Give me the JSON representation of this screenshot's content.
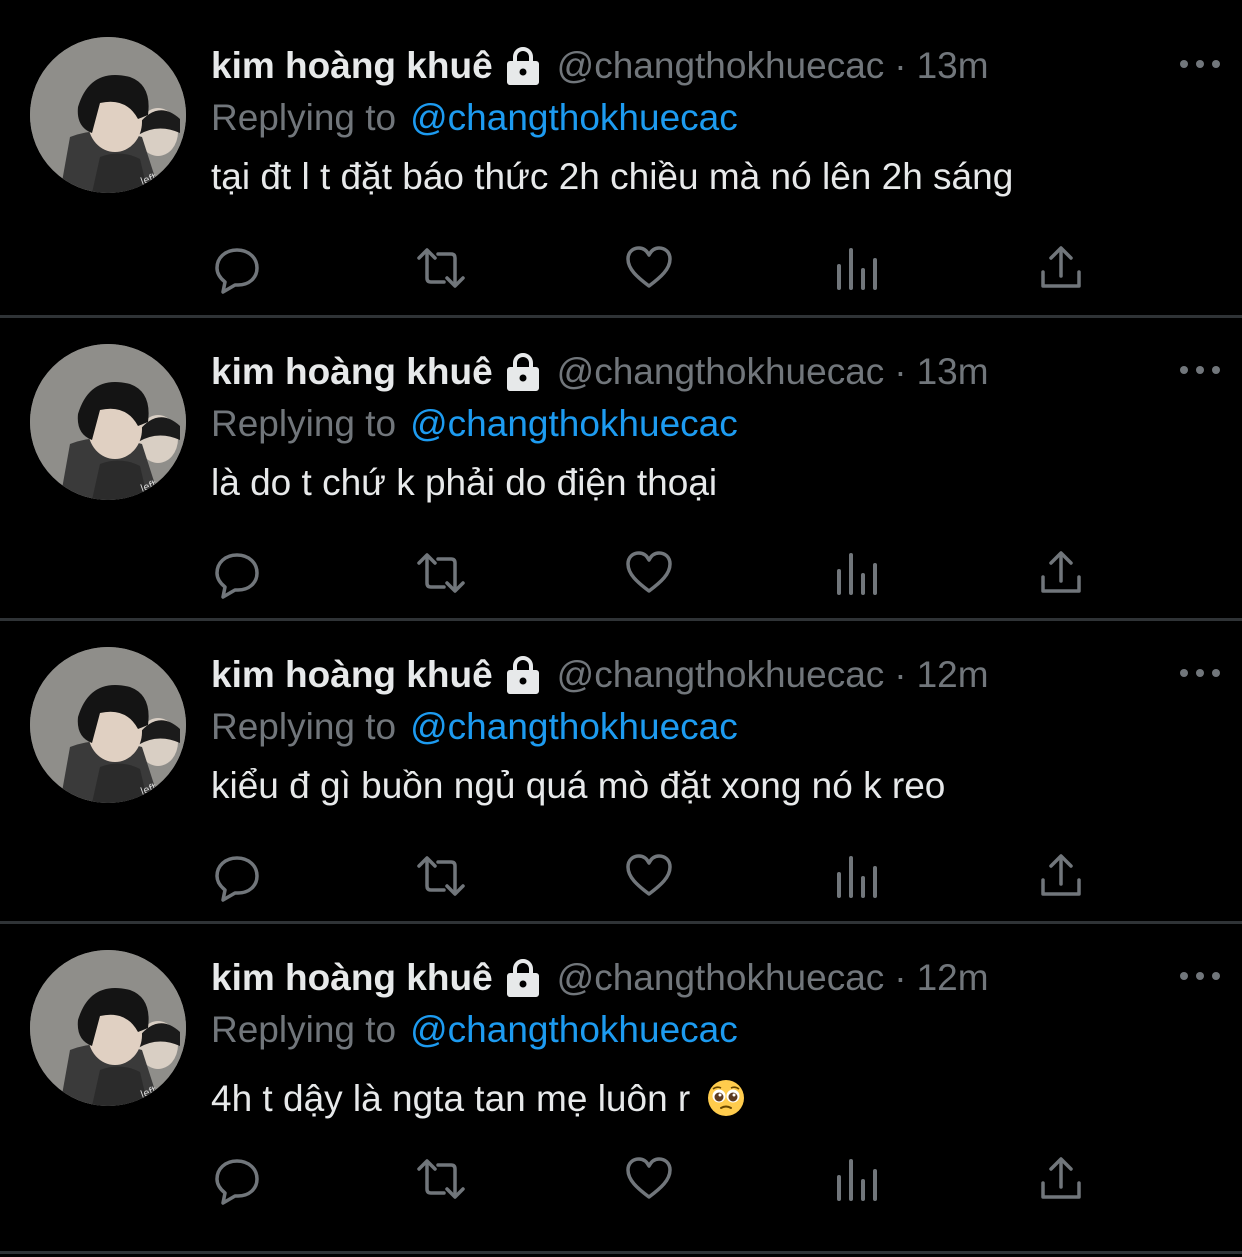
{
  "tweets": [
    {
      "name": "kim hoàng khuê",
      "handle": "@changthokhuecac",
      "dot": "·",
      "time": "13m",
      "replying_label": "Replying to",
      "replying_to": "@changthokhuecac",
      "text": "tại đt l t đặt báo thức 2h chiều mà nó lên 2h sáng",
      "emoji": ""
    },
    {
      "name": "kim hoàng khuê",
      "handle": "@changthokhuecac",
      "dot": "·",
      "time": "13m",
      "replying_label": "Replying to",
      "replying_to": "@changthokhuecac",
      "text": "là do t chứ k phải do điện thoại",
      "emoji": ""
    },
    {
      "name": "kim hoàng khuê",
      "handle": "@changthokhuecac",
      "dot": "·",
      "time": "12m",
      "replying_label": "Replying to",
      "replying_to": "@changthokhuecac",
      "text": "kiểu đ gì buồn ngủ quá mò đặt xong nó k reo",
      "emoji": ""
    },
    {
      "name": "kim hoàng khuê",
      "handle": "@changthokhuecac",
      "dot": "·",
      "time": "12m",
      "replying_label": "Replying to",
      "replying_to": "@changthokhuecac",
      "text": "4h t dậy là ngta tan mẹ luôn r",
      "emoji": "pleading-face"
    }
  ],
  "icons": {
    "reply": "comment-bubble-icon",
    "retweet": "retweet-icon",
    "like": "heart-icon",
    "views": "bar-chart-icon",
    "share": "share-upload-icon",
    "more": "more-dots-icon",
    "lock": "lock-icon"
  },
  "colors": {
    "background": "#000000",
    "text": "#e7e9ea",
    "muted": "#71767b",
    "link": "#1d9bf0",
    "divider": "#2f3336"
  }
}
